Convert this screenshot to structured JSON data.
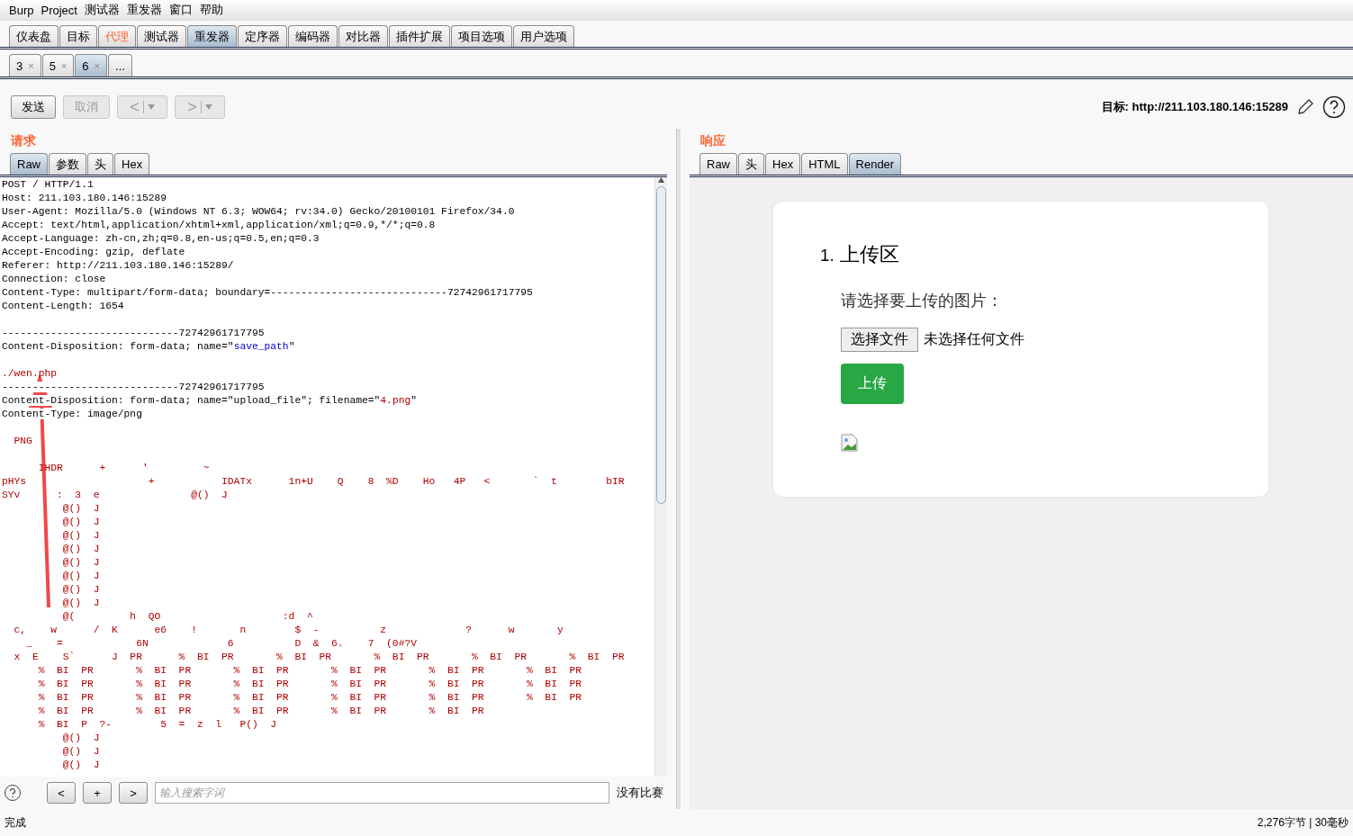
{
  "menu_bar": [
    "Burp",
    "Project",
    "测试器",
    "重发器",
    "窗口",
    "帮助"
  ],
  "main_tabs": [
    {
      "label": "仪表盘",
      "selected": false,
      "highlighted": false
    },
    {
      "label": "目标",
      "selected": false,
      "highlighted": false
    },
    {
      "label": "代理",
      "selected": false,
      "highlighted": true
    },
    {
      "label": "测试器",
      "selected": false,
      "highlighted": false
    },
    {
      "label": "重发器",
      "selected": true,
      "highlighted": false
    },
    {
      "label": "定序器",
      "selected": false,
      "highlighted": false
    },
    {
      "label": "编码器",
      "selected": false,
      "highlighted": false
    },
    {
      "label": "对比器",
      "selected": false,
      "highlighted": false
    },
    {
      "label": "插件扩展",
      "selected": false,
      "highlighted": false
    },
    {
      "label": "项目选项",
      "selected": false,
      "highlighted": false
    },
    {
      "label": "用户选项",
      "selected": false,
      "highlighted": false
    }
  ],
  "repeater_tabs": [
    {
      "label": "3",
      "close": "×",
      "selected": false
    },
    {
      "label": "5",
      "close": "×",
      "selected": false
    },
    {
      "label": "6",
      "close": "×",
      "selected": true
    },
    {
      "label": "...",
      "selected": false
    }
  ],
  "toolbar": {
    "buttons": [
      {
        "kind": "text",
        "label": "发送",
        "disabled": false
      },
      {
        "kind": "text",
        "label": "取消",
        "disabled": true
      },
      {
        "kind": "nav",
        "label": "<",
        "disabled": true
      },
      {
        "kind": "nav",
        "label": ">",
        "disabled": true
      }
    ],
    "target_label": "目标:",
    "target_url": "http://211.103.180.146:15289"
  },
  "request": {
    "title": "请求",
    "tabs": [
      {
        "label": "Raw",
        "selected": true
      },
      {
        "label": "参数",
        "selected": false
      },
      {
        "label": "头",
        "selected": false
      },
      {
        "label": "Hex",
        "selected": false
      }
    ],
    "lines": [
      {
        "kind": "text",
        "parts": [
          {
            "text": "POST / HTTP/1.1",
            "kind": "plain"
          }
        ]
      },
      {
        "kind": "text",
        "parts": [
          {
            "text": "Host: 211.103.180.146:15289",
            "kind": "plain"
          }
        ]
      },
      {
        "kind": "text",
        "parts": [
          {
            "text": "User-Agent: Mozilla/5.0 (Windows NT 6.3; WOW64; rv:34.0) Gecko/20100101 Firefox/34.0",
            "kind": "plain"
          }
        ]
      },
      {
        "kind": "text",
        "parts": [
          {
            "text": "Accept: text/html,application/xhtml+xml,application/xml;q=0.9,*/*;q=0.8",
            "kind": "plain"
          }
        ]
      },
      {
        "kind": "text",
        "parts": [
          {
            "text": "Accept-Language: zh-cn,zh;q=0.8,en-us;q=0.5,en;q=0.3",
            "kind": "plain"
          }
        ]
      },
      {
        "kind": "text",
        "parts": [
          {
            "text": "Accept-Encoding: gzip, deflate",
            "kind": "plain"
          }
        ]
      },
      {
        "kind": "text",
        "parts": [
          {
            "text": "Referer: http://211.103.180.146:15289/",
            "kind": "plain"
          }
        ]
      },
      {
        "kind": "text",
        "parts": [
          {
            "text": "Connection: close",
            "kind": "plain"
          }
        ]
      },
      {
        "kind": "text",
        "parts": [
          {
            "text": "Content-Type: multipart/form-data; boundary=-----------------------------72742961717795",
            "kind": "plain"
          }
        ]
      },
      {
        "kind": "text",
        "parts": [
          {
            "text": "Content-Length: 1654",
            "kind": "plain"
          }
        ]
      },
      {
        "kind": "blank"
      },
      {
        "kind": "text",
        "parts": [
          {
            "text": "-----------------------------72742961717795",
            "kind": "plain"
          }
        ]
      },
      {
        "kind": "text",
        "parts": [
          {
            "text": "Content-Disposition: form-data; name=\"",
            "kind": "plain"
          },
          {
            "text": "save_path",
            "kind": "param"
          },
          {
            "text": "\"",
            "kind": "plain"
          }
        ]
      },
      {
        "kind": "blank"
      },
      {
        "kind": "text",
        "parts": [
          {
            "text": "./wen.php",
            "kind": "value"
          }
        ]
      },
      {
        "kind": "text",
        "parts": [
          {
            "text": "-----------------------------72742961717795",
            "kind": "plain"
          }
        ]
      },
      {
        "kind": "text",
        "parts": [
          {
            "text": "Content-Disposition: form-data; name=\"upload_file\"; filename=\"",
            "kind": "plain"
          },
          {
            "text": "4.png",
            "kind": "value"
          },
          {
            "text": "\"",
            "kind": "plain"
          }
        ]
      },
      {
        "kind": "text",
        "parts": [
          {
            "text": "Content-Type: image/png",
            "kind": "plain"
          }
        ]
      },
      {
        "kind": "blank"
      },
      {
        "kind": "text",
        "parts": [
          {
            "text": "  PNG",
            "kind": "value"
          }
        ]
      },
      {
        "kind": "blank"
      },
      {
        "kind": "text",
        "parts": [
          {
            "text": "      IHDR      +      '         ~",
            "kind": "value"
          }
        ]
      },
      {
        "kind": "text",
        "parts": [
          {
            "text": "pHYs                    +           IDATx      1n+U    Q    8  %D    Ho   4P   <       `  t        bIR",
            "kind": "value"
          }
        ]
      },
      {
        "kind": "text",
        "parts": [
          {
            "text": "SYv      :  3  e               @()  J",
            "kind": "value"
          }
        ]
      },
      {
        "kind": "text",
        "parts": [
          {
            "text": "          @()  J",
            "kind": "value"
          }
        ]
      },
      {
        "kind": "text",
        "parts": [
          {
            "text": "          @()  J",
            "kind": "value"
          }
        ]
      },
      {
        "kind": "text",
        "parts": [
          {
            "text": "          @()  J",
            "kind": "value"
          }
        ]
      },
      {
        "kind": "text",
        "parts": [
          {
            "text": "          @()  J",
            "kind": "value"
          }
        ]
      },
      {
        "kind": "text",
        "parts": [
          {
            "text": "          @()  J",
            "kind": "value"
          }
        ]
      },
      {
        "kind": "text",
        "parts": [
          {
            "text": "          @()  J",
            "kind": "value"
          }
        ]
      },
      {
        "kind": "text",
        "parts": [
          {
            "text": "          @()  J",
            "kind": "value"
          }
        ]
      },
      {
        "kind": "text",
        "parts": [
          {
            "text": "          @()  J",
            "kind": "value"
          }
        ]
      },
      {
        "kind": "text",
        "parts": [
          {
            "text": "          @(         h  QO                    :d  ^",
            "kind": "value"
          }
        ]
      },
      {
        "kind": "text",
        "parts": [
          {
            "text": "  c,    w      /  K      e6    !       n        $  -          z             ?      w       y",
            "kind": "value"
          }
        ]
      },
      {
        "kind": "text",
        "parts": [
          {
            "text": "    _    =            6N             6          D  &  6.    7  (0#?V",
            "kind": "value"
          }
        ]
      },
      {
        "kind": "text",
        "parts": [
          {
            "text": "  x  E    S`      J  PR      %  BI  PR       %  BI  PR       %  BI  PR       %  BI  PR       %  BI  PR",
            "kind": "value"
          }
        ]
      },
      {
        "kind": "text",
        "parts": [
          {
            "text": "      %  BI  PR       %  BI  PR       %  BI  PR       %  BI  PR       %  BI  PR       %  BI  PR",
            "kind": "value"
          }
        ]
      },
      {
        "kind": "text",
        "parts": [
          {
            "text": "      %  BI  PR       %  BI  PR       %  BI  PR       %  BI  PR       %  BI  PR       %  BI  PR",
            "kind": "value"
          }
        ]
      },
      {
        "kind": "text",
        "parts": [
          {
            "text": "      %  BI  PR       %  BI  PR       %  BI  PR       %  BI  PR       %  BI  PR       %  BI  PR",
            "kind": "value"
          }
        ]
      },
      {
        "kind": "text",
        "parts": [
          {
            "text": "      %  BI  PR       %  BI  PR       %  BI  PR       %  BI  PR       %  BI  PR",
            "kind": "value"
          }
        ]
      },
      {
        "kind": "text",
        "parts": [
          {
            "text": "      %  BI  P  ?-        5  =  z  l   P()  J",
            "kind": "value"
          }
        ]
      },
      {
        "kind": "text",
        "parts": [
          {
            "text": "          @()  J",
            "kind": "value"
          }
        ]
      },
      {
        "kind": "text",
        "parts": [
          {
            "text": "          @()  J",
            "kind": "value"
          }
        ]
      },
      {
        "kind": "text",
        "parts": [
          {
            "text": "          @()  J",
            "kind": "value"
          }
        ]
      }
    ],
    "search": {
      "buttons": [
        "<",
        "+",
        ">"
      ],
      "placeholder": "输入搜索字词",
      "result": "没有比赛"
    }
  },
  "response": {
    "title": "响应",
    "tabs": [
      {
        "label": "Raw",
        "selected": false
      },
      {
        "label": "头",
        "selected": false
      },
      {
        "label": "Hex",
        "selected": false
      },
      {
        "label": "HTML",
        "selected": false
      },
      {
        "label": "Render",
        "selected": true
      }
    ],
    "render": {
      "heading_number": "1.",
      "heading": "上传区",
      "prompt": "请选择要上传的图片：",
      "file_button": "选择文件",
      "file_status": "未选择任何文件",
      "upload_button": "上传"
    }
  },
  "status_bar": {
    "left": "完成",
    "right": "2,276字节 | 30毫秒"
  }
}
